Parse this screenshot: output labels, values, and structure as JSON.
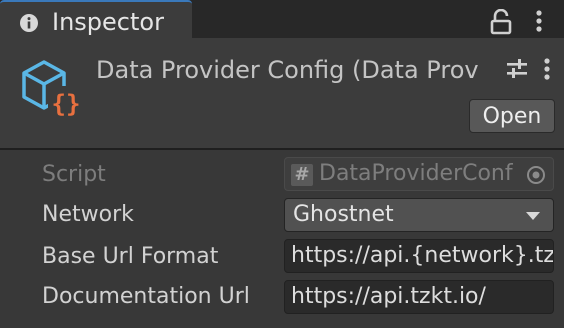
{
  "tab": {
    "title": "Inspector",
    "icon": "info-icon"
  },
  "window_controls": {
    "lock_icon": "lock-icon",
    "menu_icon": "kebab-menu-icon"
  },
  "header": {
    "title": "Data Provider Config (Data Prov",
    "asset_icon": "scriptable-object-icon",
    "settings_icon": "sliders-icon",
    "more_icon": "kebab-menu-icon",
    "open_label": "Open"
  },
  "properties": {
    "script": {
      "label": "Script",
      "value": "DataProviderConf",
      "icon": "csharp-script-icon",
      "picker_icon": "object-picker-icon"
    },
    "network": {
      "label": "Network",
      "value": "Ghostnet"
    },
    "base_url": {
      "label": "Base Url Format",
      "value": "https://api.{network}.tz"
    },
    "docs_url": {
      "label": "Documentation Url",
      "value": "https://api.tzkt.io/"
    }
  },
  "colors": {
    "accent_tab": "#3a79bb",
    "icon_blue": "#5ab7e6",
    "icon_orange": "#e8703f",
    "panel_bg": "#383838"
  }
}
